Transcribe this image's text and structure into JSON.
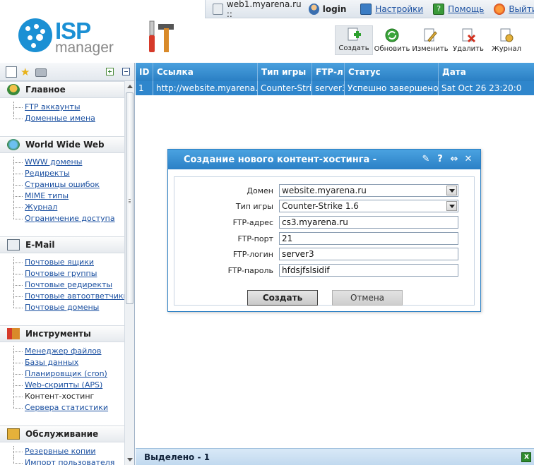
{
  "topbar": {
    "server": "web1.myarena.ru ::",
    "user": "login",
    "settings": "Настройки",
    "help": "Помощь",
    "logout": "Выйти"
  },
  "logo": {
    "isp": "ISP",
    "manager": "manager"
  },
  "toolbar": {
    "create": "Создать",
    "refresh": "Обновить",
    "edit": "Изменить",
    "delete": "Удалить",
    "log": "Журнал"
  },
  "sidebar": {
    "groups": [
      {
        "title": "Главное",
        "items": [
          "FTP аккаунты",
          "Доменные имена"
        ]
      },
      {
        "title": "World Wide Web",
        "items": [
          "WWW домены",
          "Редиректы",
          "Страницы ошибок",
          "MIME типы",
          "Журнал",
          "Ограничение доступа"
        ]
      },
      {
        "title": "E-Mail",
        "items": [
          "Почтовые ящики",
          "Почтовые группы",
          "Почтовые редиректы",
          "Почтовые автоответчики",
          "Почтовые домены"
        ]
      },
      {
        "title": "Инструменты",
        "items": [
          "Менеджер файлов",
          "Базы данных",
          "Планировщик (cron)",
          "Web-скрипты (APS)",
          "Контент-хостинг",
          "Сервера статистики"
        ]
      },
      {
        "title": "Обслуживание",
        "items": [
          "Резервные копии",
          "Импорт пользователя"
        ]
      }
    ]
  },
  "table": {
    "columns": [
      "ID",
      "Ссылка",
      "Тип игры",
      "FTP-л",
      "Статус",
      "Дата"
    ],
    "rows": [
      [
        "1",
        "http://website.myarena.",
        "Counter-Strik",
        "server3",
        "Успешно завершено",
        "Sat Oct 26 23:20:0"
      ]
    ]
  },
  "footer": {
    "selected": "Выделено - 1"
  },
  "dialog": {
    "title": "Создание нового контент-хостинга -",
    "fields": [
      {
        "label": "Домен",
        "value": "website.myarena.ru",
        "type": "select"
      },
      {
        "label": "Тип игры",
        "value": "Counter-Strike 1.6",
        "type": "select"
      },
      {
        "label": "FTP-адрес",
        "value": "cs3.myarena.ru",
        "type": "text"
      },
      {
        "label": "FTP-порт",
        "value": "21",
        "type": "text"
      },
      {
        "label": "FTP-логин",
        "value": "server3",
        "type": "text"
      },
      {
        "label": "FTP-пароль",
        "value": "hfdsjfslsidif",
        "type": "text"
      }
    ],
    "submit": "Создать",
    "cancel": "Отмена"
  }
}
